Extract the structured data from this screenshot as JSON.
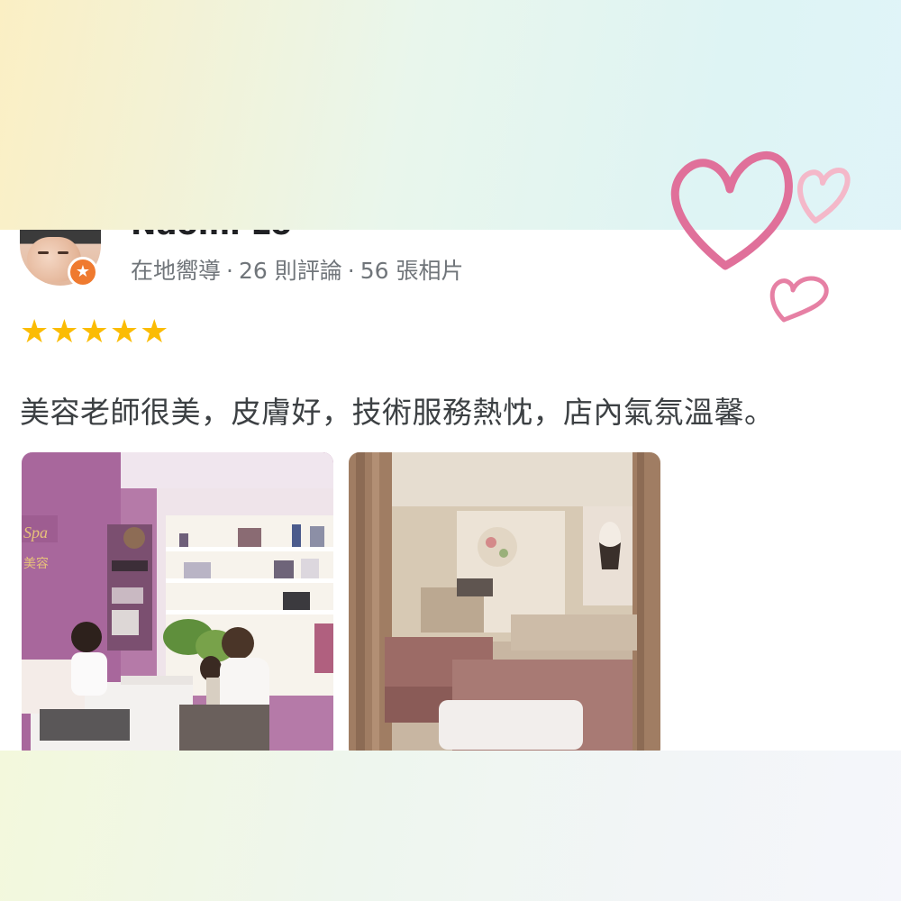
{
  "review": {
    "reviewer_name": "Naomi Lo",
    "badge_icon": "★",
    "meta": {
      "level": "在地嚮導",
      "reviews": "26 則評論",
      "photos": "56 張相片"
    },
    "stars": "★★★★★",
    "rating": 5,
    "text": "美容老師很美，皮膚好，技術服務熱忱，店內氣氛溫馨。",
    "photo_sign": "Spa",
    "photo_sign_sub": "美容"
  },
  "colors": {
    "star": "#fbbc04",
    "badge": "#ef7a2f",
    "heart": "#e0709a"
  },
  "icons": [
    "avatar",
    "local-guide-badge-icon",
    "star-icon",
    "heart-icon"
  ]
}
